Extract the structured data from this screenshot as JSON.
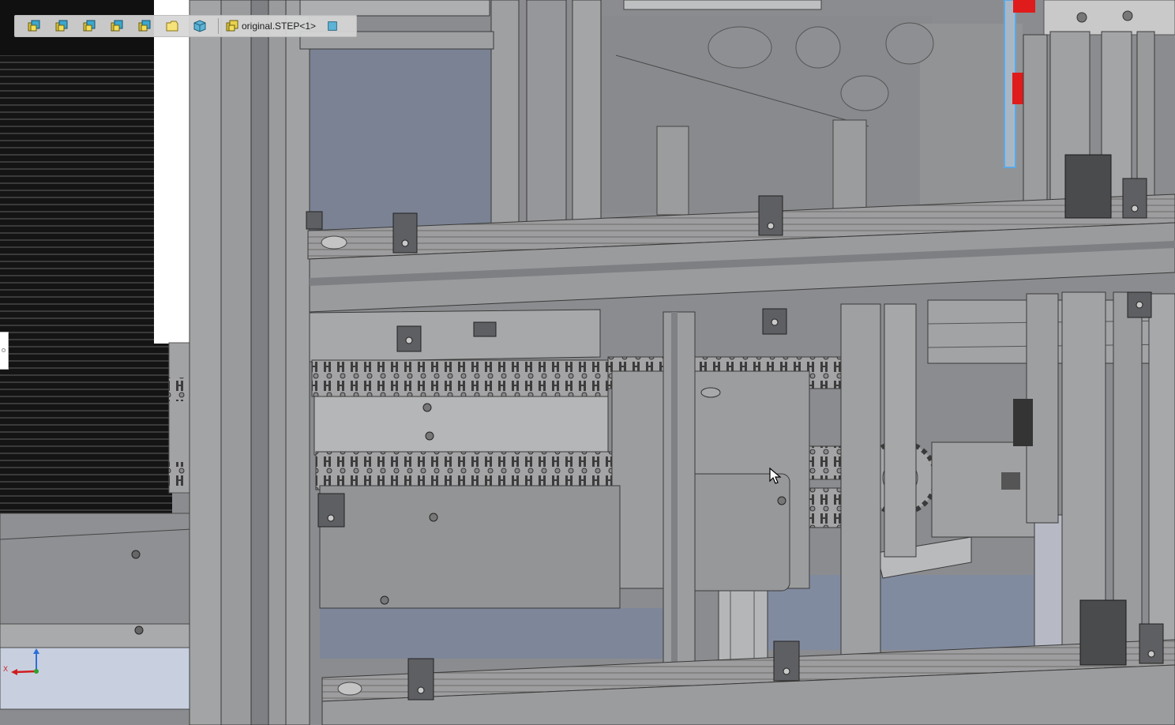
{
  "breadcrumb": {
    "items": [
      {
        "icon": "assembly-icon"
      },
      {
        "icon": "assembly-icon"
      },
      {
        "icon": "assembly-icon"
      },
      {
        "icon": "assembly-icon"
      },
      {
        "icon": "assembly-icon"
      },
      {
        "icon": "folder-icon"
      },
      {
        "icon": "part-icon"
      }
    ],
    "root_label": "original.STEP<1>",
    "root_icon": "assembly-icon",
    "end_icon": "select-part-icon"
  },
  "triad": {
    "x_label": "X"
  },
  "colors": {
    "frame": "#8c8d90",
    "accent_red": "#e01b1b",
    "selection_blue": "#5aa9e6",
    "background_glass": "#7d8597"
  }
}
